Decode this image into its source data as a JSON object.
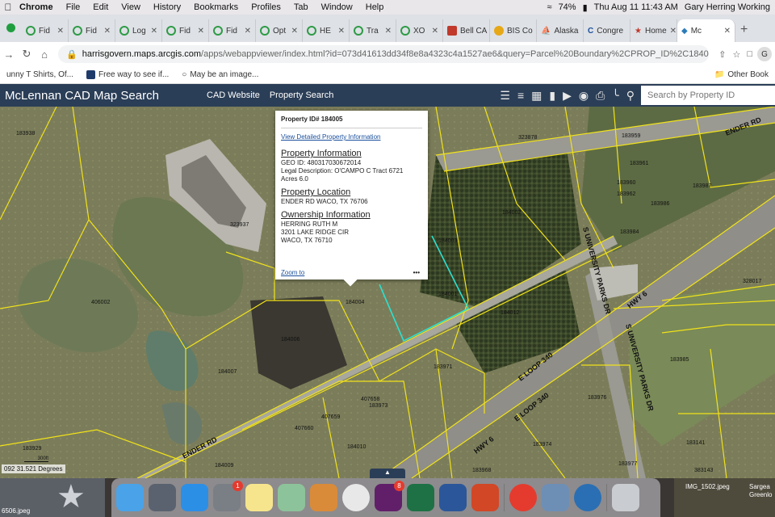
{
  "menubar": {
    "app": "Chrome",
    "items": [
      "File",
      "Edit",
      "View",
      "History",
      "Bookmarks",
      "Profiles",
      "Tab",
      "Window",
      "Help"
    ],
    "battery": "74%",
    "clock": "Thu Aug 11  11:43 AM",
    "user": "Gary Herring Working"
  },
  "tabs": [
    {
      "label": "Fid",
      "icon": "green-circle-icon"
    },
    {
      "label": "Fid",
      "icon": "green-circle-icon"
    },
    {
      "label": "Log",
      "icon": "green-circle-icon"
    },
    {
      "label": "Fid",
      "icon": "green-circle-icon"
    },
    {
      "label": "Fid",
      "icon": "green-circle-icon"
    },
    {
      "label": "Opt",
      "icon": "green-circle-icon"
    },
    {
      "label": "HE",
      "icon": "green-circle-icon"
    },
    {
      "label": "Tra",
      "icon": "green-circle-icon"
    },
    {
      "label": "XO",
      "icon": "green-circle-icon"
    },
    {
      "label": "Bell CA",
      "icon": "red-square-icon"
    },
    {
      "label": "BIS Co",
      "icon": "yellow-circle-icon"
    },
    {
      "label": "Alaska",
      "icon": "ship-icon"
    },
    {
      "label": "Congre",
      "icon": "c-icon"
    },
    {
      "label": "Home",
      "icon": "texas-flag-icon"
    },
    {
      "label": "Mc",
      "icon": "arcgis-icon"
    }
  ],
  "address": {
    "host": "harrisgovern.maps.arcgis.com",
    "path": "/apps/webappviewer/index.html?id=073d41613dd34f8e8a4323c4a1527ae6&query=Parcel%20Boundary%2CPROP_ID%2C184005",
    "profile_initial": "G"
  },
  "bookmarks": {
    "items": [
      "unny T Shirts, Of...",
      "Free way to see if...",
      "May be an image..."
    ],
    "other": "Other Book"
  },
  "app": {
    "title": "McLennan CAD Map Search",
    "links": [
      "CAD Website",
      "Property Search"
    ],
    "search_placeholder": "Search by Property ID"
  },
  "popup": {
    "title": "Property ID# 184005",
    "detail_link": "View Detailed Property Information",
    "property_info_heading": "Property  Information",
    "geo_id": "GEO ID: 480317030672014",
    "legal": "Legal Description: O'CAMPO C Tract 6721",
    "acres": "Acres 6.0",
    "location_heading": "Property Location",
    "location": "ENDER RD WACO, TX 76706",
    "owner_heading": "Ownership Information",
    "owner_name": "HERRING RUTH M",
    "owner_addr1": "3201 LAKE RIDGE CIR",
    "owner_addr2": "WACO, TX  76710",
    "zoom_link": "Zoom to",
    "more": "•••"
  },
  "map": {
    "coords": "092 31.521 Degrees",
    "scale": "300ft",
    "parcel_labels": [
      "183938",
      "323937",
      "406002",
      "184006",
      "184007",
      "184004",
      "184003",
      "184001",
      "184002",
      "184012",
      "183971",
      "183973",
      "407658",
      "407659",
      "407660",
      "184010",
      "184009",
      "183929",
      "183974",
      "183968",
      "183976",
      "183985",
      "183959",
      "183960",
      "183961",
      "183962",
      "183986",
      "183984",
      "183987",
      "183977",
      "183141",
      "383143",
      "328017",
      "323878"
    ],
    "road_labels": [
      "ENDER RD",
      "ENDER RD",
      "HWY 6",
      "HWY 6",
      "E LOOP 340",
      "E LOOP 340",
      "S UNIVERSITY PARKS DR",
      "S UNIVERSITY PARKS DR"
    ]
  },
  "dock": {
    "mail_badge": "1",
    "slack_badge": "8"
  },
  "desktop": {
    "left_file": "6506.jpeg",
    "right_file": "IMG_1502.jpeg",
    "right_text1": "Sargea",
    "right_text2": "Greenlo"
  }
}
